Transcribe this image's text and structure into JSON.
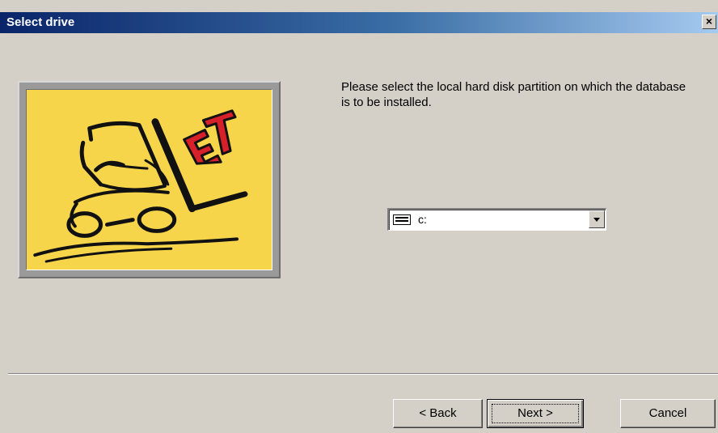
{
  "window": {
    "title": "Select drive",
    "close_label": "×"
  },
  "logo": {
    "icon": "forklift-et-logo",
    "text": "ET",
    "colors": {
      "background": "#f6d54a",
      "lettering": "#d6202a",
      "ink": "#111111"
    }
  },
  "main": {
    "instruction": "Please select the local hard disk partition on which the database is to be installed.",
    "drive_select": {
      "selected_value": "c:",
      "icon": "drive-icon"
    }
  },
  "buttons": {
    "back": "< Back",
    "next": "Next >",
    "cancel": "Cancel"
  }
}
